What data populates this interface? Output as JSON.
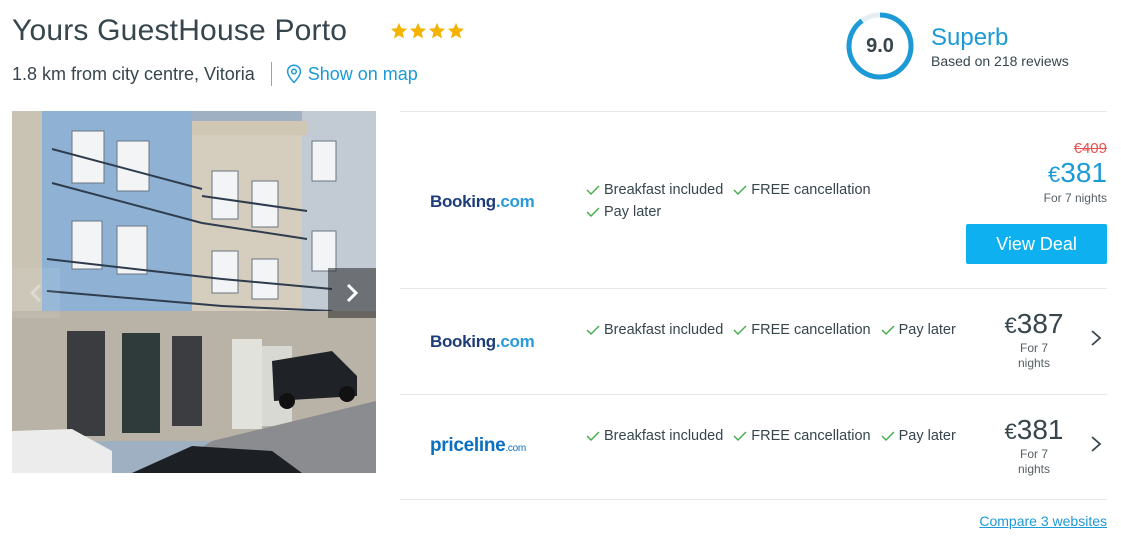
{
  "hotel": {
    "name": "Yours GuestHouse Porto",
    "stars": 4,
    "distance": "1.8 km from city centre, Vitoria",
    "map_link": "Show on map"
  },
  "rating": {
    "score": "9.0",
    "label": "Superb",
    "reviews": "Based on 218 reviews"
  },
  "deals": [
    {
      "provider": {
        "name": "Booking",
        "suffix": ".com"
      },
      "features": [
        "Breakfast included",
        "FREE cancellation",
        "Pay later"
      ],
      "old_price": "€409",
      "currency": "€",
      "price": "381",
      "nights": "For 7 nights",
      "cta": "View Deal"
    },
    {
      "provider": {
        "name": "Booking",
        "suffix": ".com"
      },
      "features": [
        "Breakfast included",
        "FREE cancellation",
        "Pay later"
      ],
      "currency": "€",
      "price": "387",
      "nights_line1": "For 7",
      "nights_line2": "nights"
    },
    {
      "provider": {
        "name": "priceline",
        "suffix": ".com"
      },
      "features": [
        "Breakfast included",
        "FREE cancellation",
        "Pay later"
      ],
      "currency": "€",
      "price": "381",
      "nights_line1": "For 7",
      "nights_line2": "nights"
    }
  ],
  "compare_link": "Compare 3 websites",
  "colors": {
    "accent": "#1c9ad6",
    "button": "#0eb0ef",
    "star": "#f5b301",
    "check": "#3fae49",
    "strike": "#e55353"
  },
  "icons": {
    "star": "star-icon",
    "map": "map-pin-icon",
    "check": "check-icon",
    "chevron": "chevron-right-icon"
  }
}
